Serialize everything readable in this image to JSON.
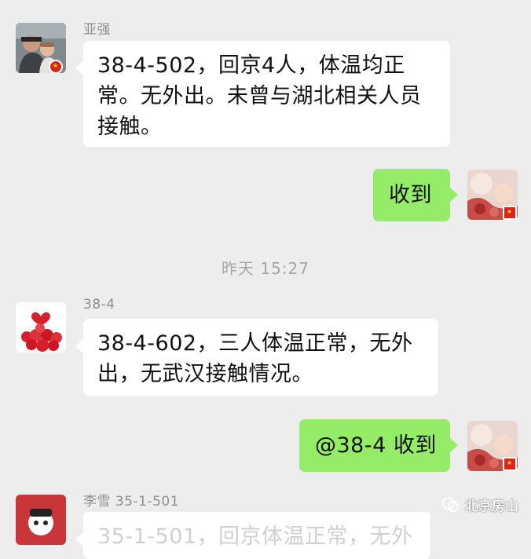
{
  "theme": {
    "background": "#ededed",
    "incoming_bubble": "#ffffff",
    "outgoing_bubble": "#95ec69"
  },
  "messages": [
    {
      "sender": "亚强",
      "text": "38-4-502，回京4人，体温均正常。无外出。未曾与湖北相关人员接触。",
      "direction": "incoming"
    },
    {
      "text": "收到",
      "direction": "outgoing"
    },
    {
      "timestamp": "昨天 15:27"
    },
    {
      "sender": "38-4",
      "text": "38-4-602，三人体温正常，无外出，无武汉接触情况。",
      "direction": "incoming"
    },
    {
      "text": "@38-4 收到",
      "direction": "outgoing"
    },
    {
      "sender": "李雪 35-1-501",
      "text": "35-1-501，回京体温正常，无外",
      "direction": "incoming"
    }
  ],
  "watermark": {
    "label": "北京房山",
    "icon": "wechat-channel-icon"
  }
}
